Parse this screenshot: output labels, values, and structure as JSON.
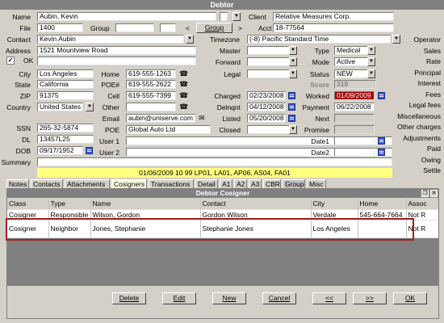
{
  "window": {
    "title": "Debtor"
  },
  "debtor": {
    "name_label": "Name",
    "name": "Aubin, Kevin",
    "file_label": "File",
    "file": "1400",
    "group_label": "Group",
    "group_value": "",
    "contact_label": "Contact",
    "contact": "Kevin Aubin",
    "address_label": "Address",
    "address": "1521 Mountview Road",
    "ok_label": "OK",
    "ok_checked": "✓",
    "city_label": "City",
    "city": "Los Angeles",
    "state_label": "State",
    "state": "California",
    "zip_label": "ZIP",
    "zip": "91375",
    "country_label": "Country",
    "country": "United States",
    "ssn_label": "SSN",
    "ssn": "265-32-5874",
    "dl_label": "DL",
    "dl": "13457L25",
    "dob_label": "DOB",
    "dob": "09/17/1952",
    "summary_label": "Summary",
    "home_label": "Home",
    "home": "619-555-1263",
    "poe_num_label": "POE#",
    "poe_num": "619-555-2622",
    "cell_label": "Cell",
    "cell": "619-555-7399",
    "other_label": "Other",
    "other": "",
    "email_label": "Email",
    "email": "aubin@uniserve.com",
    "poe_label": "POE",
    "poe": "Global Auto Ltd",
    "user1_label": "User 1",
    "user1": "",
    "user2_label": "User 2",
    "user2": "",
    "client_label": "Client",
    "client": "Relative Measures Corp.",
    "acct_label": "Acct",
    "acct": "18-77564",
    "group_button": "Group",
    "group_prev": "<",
    "group_next": ">",
    "timezone_label": "Timezone",
    "timezone": "(-8) Pacific Standard Time",
    "master_label": "Master",
    "master": "",
    "forward_label": "Forward",
    "forward": "",
    "legal_label": "Legal",
    "legal": "",
    "charged_label": "Charged",
    "charged": "02/23/2008",
    "delnqnt_label": "Delnqnt",
    "delnqnt": "04/12/2008",
    "listed_label": "Listed",
    "listed": "05/20/2008",
    "closed_label": "Closed",
    "closed": "",
    "type_label": "Type",
    "type": "Medical",
    "mode_label": "Mode",
    "mode": "Active",
    "status_label": "Status",
    "status": "NEW",
    "score_label": "Score",
    "score": "318",
    "worked_label": "Worked",
    "worked": "01/09/2009",
    "payment_label": "Payment",
    "payment": "06/22/2008",
    "next_label": "Next",
    "next": "",
    "promise_label": "Promise",
    "promise": "",
    "date1_label": "Date1",
    "date1": "",
    "date2_label": "Date2",
    "date2": "",
    "right_labels": [
      "Operator",
      "Sales",
      "Rate",
      "Principal",
      "Interest",
      "Fees",
      "Legal fees",
      "Miscellaneous",
      "Other charges",
      "Adjustments",
      "Paid",
      "Owing",
      "Settle"
    ],
    "banner": "01/06/2009  10 99 LP01, LA01, AP06, AS04, FA01"
  },
  "tabs": [
    "Notes",
    "Contacts",
    "Attachments",
    "Cosigners",
    "Transactions",
    "Detail",
    "A1",
    "A2",
    "A3",
    "CBR",
    "Group",
    "Misc"
  ],
  "active_tab": "Cosigners",
  "cosigner_panel": {
    "title": "Debtor Cosigner",
    "columns": [
      "Class",
      "Type",
      "Name",
      "Contact",
      "City",
      "Home",
      "Assoc"
    ],
    "rows": [
      [
        "Cosigner",
        "Responsible",
        "Wilson, Gordon",
        "Gordon Wilson",
        "Verdale",
        "545-664-7664",
        "Not R"
      ],
      [
        "Cosigner",
        "Neighbor",
        "Jones, Stephanie",
        "Stephanie Jones",
        "Los Angeles",
        "",
        "Not R"
      ]
    ],
    "buttons": {
      "delete": "Delete",
      "edit": "Edit",
      "new": "New",
      "cancel": "Cancel",
      "prev": "<<",
      "next": ">>",
      "ok": "OK"
    }
  },
  "colors": {
    "titlebar": "#808080",
    "banner": "#ffff80",
    "highlight_box": "#a02020",
    "worked_bg": "#a00000",
    "list_bg": "#808080"
  },
  "icons": {
    "phone": "phone-icon",
    "calendar": "calendar-icon",
    "email": "email-icon",
    "dropdown": "chevron-down-icon"
  }
}
